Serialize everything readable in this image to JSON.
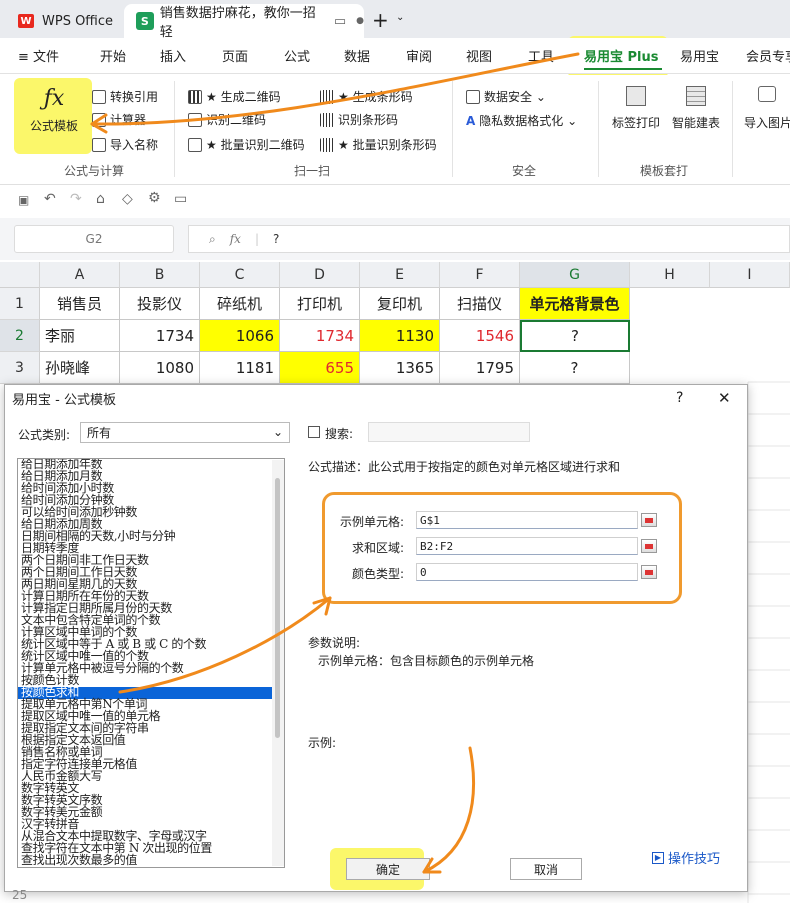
{
  "tabs": {
    "app": "WPS Office",
    "app_logo": "W",
    "doc": "销售数据拧麻花，教你一招轻",
    "doc_logo": "S"
  },
  "menu": [
    "文件",
    "开始",
    "插入",
    "页面",
    "公式",
    "数据",
    "审阅",
    "视图",
    "工具",
    "易用宝 Plus",
    "易用宝",
    "会员专享"
  ],
  "ribbon": {
    "fx_icon": "ƒx",
    "formula_template": "公式模板",
    "convert_ref": "转换引用",
    "calculator": "计算器",
    "import_name": "导入名称",
    "group_formula": "公式与计算",
    "gen_qr": "★ 生成二维码",
    "recog_qr": "识别二维码",
    "batch_qr": "★ 批量识别二维码",
    "gen_bar": "★ 生成条形码",
    "recog_bar": "识别条形码",
    "batch_bar": "★ 批量识别条形码",
    "group_scan": "扫一扫",
    "data_security": "数据安全 ⌄",
    "privacy": "隐私数据格式化 ⌄",
    "group_security": "安全",
    "label_print": "标签打印",
    "smart_table": "智能建表",
    "group_template": "模板套打",
    "import_image": "导入图片"
  },
  "formula_bar": {
    "cell_ref": "G2",
    "fx": "fx",
    "content": "?"
  },
  "grid": {
    "columns": [
      "A",
      "B",
      "C",
      "D",
      "E",
      "F",
      "G",
      "H",
      "I"
    ],
    "rows": [
      "1",
      "2",
      "3"
    ],
    "header": [
      "销售员",
      "投影仪",
      "碎纸机",
      "打印机",
      "复印机",
      "扫描仪",
      "单元格背景色"
    ],
    "row2": [
      "李丽",
      "1734",
      "1066",
      "1734",
      "1130",
      "1546",
      "?"
    ],
    "row3": [
      "孙晓峰",
      "1080",
      "1181",
      "655",
      "1365",
      "1795",
      "?"
    ]
  },
  "dialog": {
    "title": "易用宝 - 公式模板",
    "help": "?",
    "close": "✕",
    "category_label": "公式类别:",
    "category_value": "所有",
    "search_label": "搜索:",
    "desc": "公式描述：此公式用于按指定的颜色对单元格区域进行求和",
    "params": [
      {
        "label": "示例单元格:",
        "value": "G$1"
      },
      {
        "label": "求和区域:",
        "value": "B2:F2"
      },
      {
        "label": "颜色类型:",
        "value": "0"
      }
    ],
    "param_desc_title": "参数说明:",
    "param_desc": "示例单元格：包含目标颜色的示例单元格",
    "example_label": "示例:",
    "ok": "确定",
    "cancel": "取消",
    "tips": "操作技巧",
    "list": [
      "给日期添加年数",
      "给日期添加月数",
      "给时间添加小时数",
      "给时间添加分钟数",
      "可以给时间添加秒钟数",
      "给日期添加周数",
      "日期间相隔的天数,小时与分钟",
      "日期转季度",
      "两个日期间非工作日天数",
      "两个日期间工作日天数",
      "两日期间星期几的天数",
      "计算日期所在年份的天数",
      "计算指定日期所属月份的天数",
      "文本中包含特定单词的个数",
      "计算区域中单词的个数",
      "统计区域中等于 A 或 B 或 C 的个数",
      "统计区域中唯一值的个数",
      "计算单元格中被逗号分隔的个数",
      "按颜色计数",
      "按颜色求和",
      "提取单元格中第N个单词",
      "提取区域中唯一值的单元格",
      "提取指定文本间的字符串",
      "根据指定文本返回值",
      "销售名称或单词",
      "指定字符连接单元格值",
      "人民币金额大写",
      "数字转英文",
      "数字转英文序数",
      "数字转美元金额",
      "汉字转拼音",
      "从混合文本中提取数字、字母或汉字",
      "查找字符在文本中第 N 次出现的位置",
      "查找出现次数最多的值"
    ],
    "selected_index": 19
  }
}
